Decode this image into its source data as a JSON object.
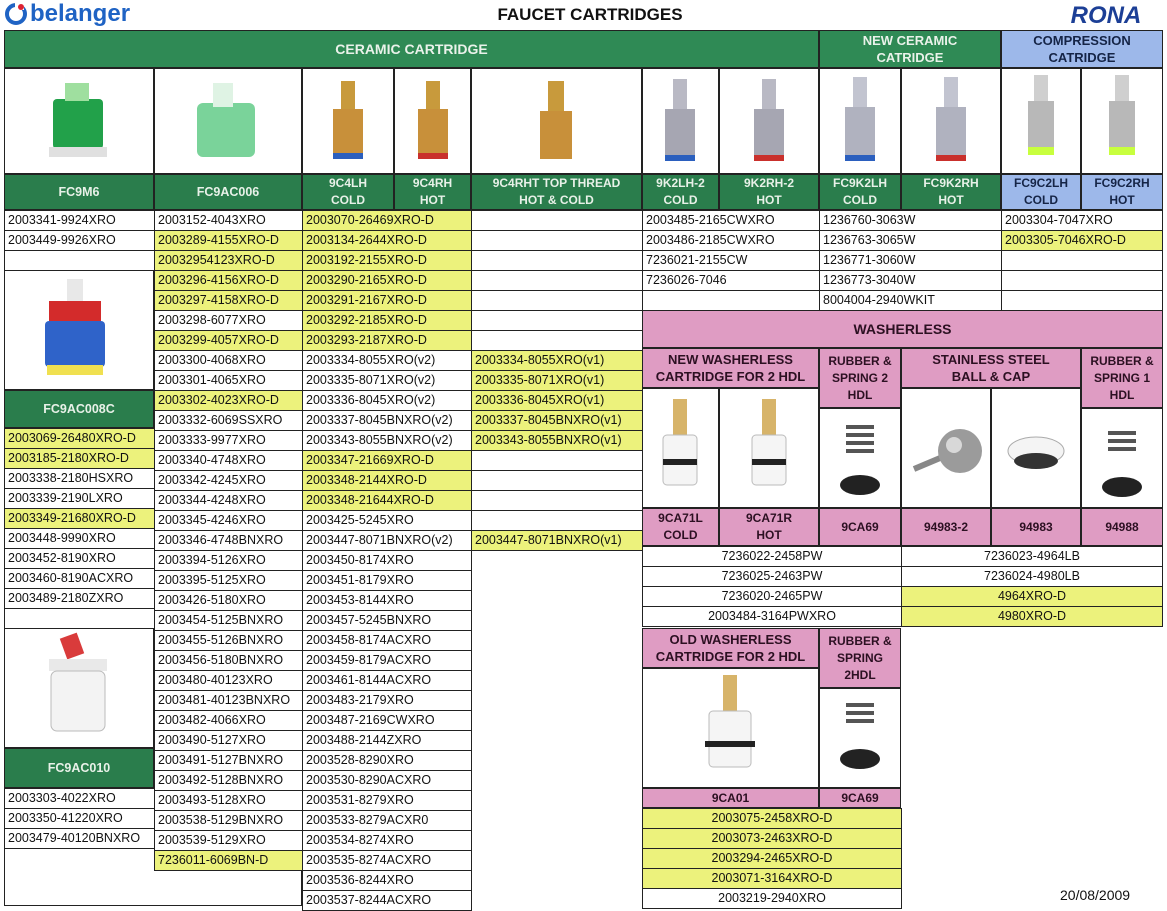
{
  "brand_left": "belanger",
  "brand_right": "RONA",
  "title": "FAUCET CARTRIDGES",
  "date": "20/08/2009",
  "colors": {
    "green": "#2f8a55",
    "blue": "#9db8ea",
    "pink": "#df9cc3",
    "yellow": "#ecf27c"
  },
  "sections": {
    "ceramic": "CERAMIC CARTRIDGE",
    "new_ceramic": "NEW CERAMIC CATRIDGE",
    "compression": "COMPRESSION CATRIDGE",
    "washerless": "WASHERLESS"
  },
  "models": {
    "fc9m6": "FC9M6",
    "fc9ac006": "FC9AC006",
    "fc9ac008c": "FC9AC008C",
    "fc9ac010": "FC9AC010",
    "c9c4lh": "9C4LH COLD",
    "c9c4rh": "9C4RH HOT",
    "c9c4rht": "9C4RHT TOP THREAD HOT & COLD",
    "k2lh": "9K2LH-2 COLD",
    "k2rh": "9K2RH-2 HOT",
    "fc9k2lh": "FC9K2LH COLD",
    "fc9k2rh": "FC9K2RH HOT",
    "fc9c2lh": "FC9C2LH COLD",
    "fc9c2rh": "FC9C2RH HOT"
  },
  "washerless": {
    "new_wl": "NEW WASHERLESS CARTRIDGE FOR 2 HDL",
    "rs2": "RUBBER & SPRING 2 HDL",
    "ss_ball": "STAINLESS STEEL BALL & CAP",
    "rs1": "RUBBER & SPRING 1 HDL",
    "ca71l": "9CA71L COLD",
    "ca71r": "9CA71R HOT",
    "ca69": "9CA69",
    "p94983_2": "94983-2",
    "p94983": "94983",
    "p94988": "94988",
    "old_wl": "OLD WASHERLESS CARTRIDGE FOR 2 HDL",
    "rs2b": "RUBBER & SPRING 2HDL",
    "ca01": "9CA01",
    "ca69b": "9CA69"
  },
  "col_fc9m6": [
    {
      "t": "2003341-9924XRO",
      "h": 0
    },
    {
      "t": "2003449-9926XRO",
      "h": 0
    },
    {
      "t": "",
      "h": 0
    }
  ],
  "col_fc9m6_b": [
    {
      "t": "2003069-26480XRO-D",
      "h": 1
    },
    {
      "t": "2003185-2180XRO-D",
      "h": 1
    },
    {
      "t": "2003338-2180HSXRO",
      "h": 0
    },
    {
      "t": "2003339-2190LXRO",
      "h": 0
    },
    {
      "t": "2003349-21680XRO-D",
      "h": 1
    },
    {
      "t": "2003448-9990XRO",
      "h": 0
    },
    {
      "t": "2003452-8190XRO",
      "h": 0
    },
    {
      "t": "2003460-8190ACXRO",
      "h": 0
    },
    {
      "t": "2003489-2180ZXRO",
      "h": 0
    },
    {
      "t": "",
      "h": 0
    }
  ],
  "col_fc9m6_c": [
    {
      "t": "2003303-4022XRO",
      "h": 0
    },
    {
      "t": "2003350-41220XRO",
      "h": 0
    },
    {
      "t": "2003479-40120BNXRO",
      "h": 0
    }
  ],
  "col_ac006": [
    {
      "t": "2003152-4043XRO",
      "h": 0
    },
    {
      "t": "2003289-4155XRO-D",
      "h": 1
    },
    {
      "t": "20032954123XRO-D",
      "h": 1
    },
    {
      "t": "2003296-4156XRO-D",
      "h": 1
    },
    {
      "t": "2003297-4158XRO-D",
      "h": 1
    },
    {
      "t": "2003298-6077XRO",
      "h": 0
    },
    {
      "t": "2003299-4057XRO-D",
      "h": 1
    },
    {
      "t": "2003300-4068XRO",
      "h": 0
    },
    {
      "t": "2003301-4065XRO",
      "h": 0
    },
    {
      "t": "2003302-4023XRO-D",
      "h": 1
    },
    {
      "t": "2003332-6069SSXRO",
      "h": 0
    },
    {
      "t": "2003333-9977XRO",
      "h": 0
    },
    {
      "t": "2003340-4748XRO",
      "h": 0
    },
    {
      "t": "2003342-4245XRO",
      "h": 0
    },
    {
      "t": "2003344-4248XRO",
      "h": 0
    },
    {
      "t": "2003345-4246XRO",
      "h": 0
    },
    {
      "t": "2003346-4748BNXRO",
      "h": 0
    },
    {
      "t": "2003394-5126XRO",
      "h": 0
    },
    {
      "t": "2003395-5125XRO",
      "h": 0
    },
    {
      "t": "2003426-5180XRO",
      "h": 0
    },
    {
      "t": "2003454-5125BNXRO",
      "h": 0
    },
    {
      "t": "2003455-5126BNXRO",
      "h": 0
    },
    {
      "t": "2003456-5180BNXRO",
      "h": 0
    },
    {
      "t": "2003480-40123XRO",
      "h": 0
    },
    {
      "t": "2003481-40123BNXRO",
      "h": 0
    },
    {
      "t": "2003482-4066XRO",
      "h": 0
    },
    {
      "t": "2003490-5127XRO",
      "h": 0
    },
    {
      "t": "2003491-5127BNXRO",
      "h": 0
    },
    {
      "t": "2003492-5128BNXRO",
      "h": 0
    },
    {
      "t": "2003493-5128XRO",
      "h": 0
    },
    {
      "t": "2003538-5129BNXRO",
      "h": 0
    },
    {
      "t": "2003539-5129XRO",
      "h": 0
    },
    {
      "t": "7236011-6069BN-D",
      "h": 1
    }
  ],
  "col_9c4": [
    {
      "t": "2003070-26469XRO-D",
      "h": 1
    },
    {
      "t": "2003134-2644XRO-D",
      "h": 1
    },
    {
      "t": "2003192-2155XRO-D",
      "h": 1
    },
    {
      "t": "2003290-2165XRO-D",
      "h": 1
    },
    {
      "t": "2003291-2167XRO-D",
      "h": 1
    },
    {
      "t": "2003292-2185XRO-D",
      "h": 1
    },
    {
      "t": "2003293-2187XRO-D",
      "h": 1
    },
    {
      "t": "2003334-8055XRO(v2)",
      "h": 0
    },
    {
      "t": "2003335-8071XRO(v2)",
      "h": 0
    },
    {
      "t": "2003336-8045XRO(v2)",
      "h": 0
    },
    {
      "t": "2003337-8045BNXRO(v2)",
      "h": 0
    },
    {
      "t": "2003343-8055BNXRO(v2)",
      "h": 0
    },
    {
      "t": "2003347-21669XRO-D",
      "h": 1
    },
    {
      "t": "2003348-2144XRO-D",
      "h": 1
    },
    {
      "t": "2003348-21644XRO-D",
      "h": 1
    },
    {
      "t": "2003425-5245XRO",
      "h": 0
    },
    {
      "t": "2003447-8071BNXRO(v2)",
      "h": 0
    },
    {
      "t": "2003450-8174XRO",
      "h": 0
    },
    {
      "t": "2003451-8179XRO",
      "h": 0
    },
    {
      "t": "2003453-8144XRO",
      "h": 0
    },
    {
      "t": "2003457-5245BNXRO",
      "h": 0
    },
    {
      "t": "2003458-8174ACXRO",
      "h": 0
    },
    {
      "t": "2003459-8179ACXRO",
      "h": 0
    },
    {
      "t": "2003461-8144ACXRO",
      "h": 0
    },
    {
      "t": "2003483-2179XRO",
      "h": 0
    },
    {
      "t": "2003487-2169CWXRO",
      "h": 0
    },
    {
      "t": "2003488-2144ZXRO",
      "h": 0
    },
    {
      "t": "2003528-8290XRO",
      "h": 0
    },
    {
      "t": "2003530-8290ACXRO",
      "h": 0
    },
    {
      "t": "2003531-8279XRO",
      "h": 0
    },
    {
      "t": "2003533-8279ACXR0",
      "h": 0
    },
    {
      "t": "2003534-8274XRO",
      "h": 0
    },
    {
      "t": "2003535-8274ACXRO",
      "h": 0
    },
    {
      "t": "2003536-8244XRO",
      "h": 0
    },
    {
      "t": "2003537-8244ACXRO",
      "h": 0
    }
  ],
  "col_9c4rht": [
    {
      "t": "",
      "h": 0
    },
    {
      "t": "",
      "h": 0
    },
    {
      "t": "",
      "h": 0
    },
    {
      "t": "",
      "h": 0
    },
    {
      "t": "",
      "h": 0
    },
    {
      "t": "",
      "h": 0
    },
    {
      "t": "",
      "h": 0
    },
    {
      "t": "2003334-8055XRO(v1)",
      "h": 1
    },
    {
      "t": "2003335-8071XRO(v1)",
      "h": 1
    },
    {
      "t": "2003336-8045XRO(v1)",
      "h": 1
    },
    {
      "t": "2003337-8045BNXRO(v1)",
      "h": 1
    },
    {
      "t": "2003343-8055BNXRO(v1)",
      "h": 1
    },
    {
      "t": "",
      "h": 0
    },
    {
      "t": "",
      "h": 0
    },
    {
      "t": "",
      "h": 0
    },
    {
      "t": "",
      "h": 0
    },
    {
      "t": "2003447-8071BNXRO(v1)",
      "h": 1
    }
  ],
  "col_9k2": [
    {
      "t": "2003485-2165CWXRO",
      "h": 0
    },
    {
      "t": "2003486-2185CWXRO",
      "h": 0
    },
    {
      "t": "7236021-2155CW",
      "h": 0
    },
    {
      "t": "7236026-7046",
      "h": 0
    },
    {
      "t": "",
      "h": 0
    }
  ],
  "col_fc9k2": [
    {
      "t": "1236760-3063W",
      "h": 0
    },
    {
      "t": "1236763-3065W",
      "h": 0
    },
    {
      "t": "1236771-3060W",
      "h": 0
    },
    {
      "t": "1236773-3040W",
      "h": 0
    },
    {
      "t": "8004004-2940WKIT",
      "h": 0
    }
  ],
  "col_fc9c2": [
    {
      "t": "2003304-7047XRO",
      "h": 0
    },
    {
      "t": "2003305-7046XRO-D",
      "h": 1
    },
    {
      "t": "",
      "h": 0
    },
    {
      "t": "",
      "h": 0
    },
    {
      "t": "",
      "h": 0
    }
  ],
  "col_new_wl": [
    {
      "t": "7236022-2458PW",
      "h": 0
    },
    {
      "t": "7236025-2463PW",
      "h": 0
    },
    {
      "t": "7236020-2465PW",
      "h": 0
    },
    {
      "t": "2003484-3164PWXRO",
      "h": 0
    }
  ],
  "col_ss": [
    {
      "t": "7236023-4964LB",
      "h": 0
    },
    {
      "t": "7236024-4980LB",
      "h": 0
    },
    {
      "t": "4964XRO-D",
      "h": 1
    },
    {
      "t": "4980XRO-D",
      "h": 1
    }
  ],
  "col_old_wl": [
    {
      "t": "2003075-2458XRO-D",
      "h": 1
    },
    {
      "t": "2003073-2463XRO-D",
      "h": 1
    },
    {
      "t": "2003294-2465XRO-D",
      "h": 1
    },
    {
      "t": "2003071-3164XRO-D",
      "h": 1
    },
    {
      "t": "2003219-2940XRO",
      "h": 0
    }
  ]
}
